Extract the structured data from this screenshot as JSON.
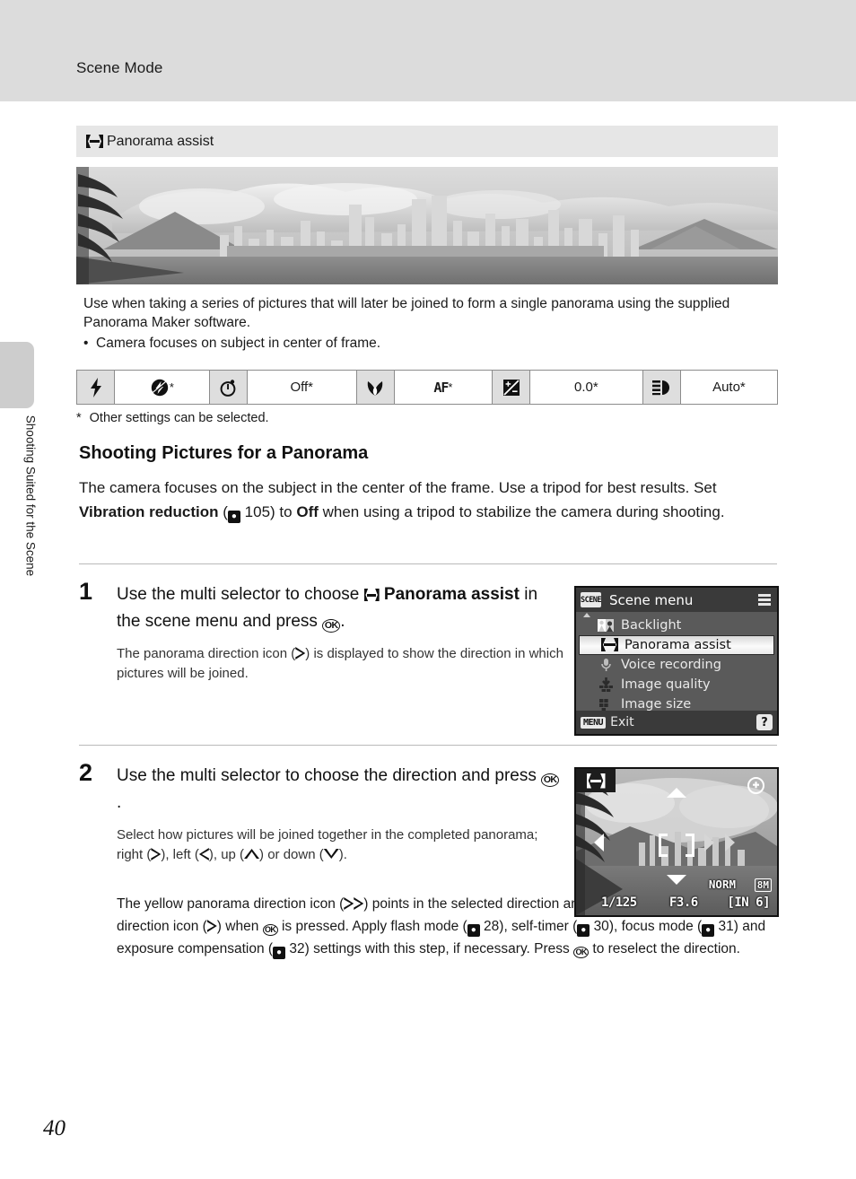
{
  "header": {
    "title": "Scene Mode"
  },
  "side_tab": {
    "label": "Shooting Suited for the Scene"
  },
  "scene_bar": {
    "label": "Panorama assist",
    "icon": "panorama-icon"
  },
  "description": {
    "line1": "Use when taking a series of pictures that will later be joined to form a single panorama using the supplied Panorama Maker software.",
    "bullet1": "Camera focuses on subject in center of frame."
  },
  "settings_row": {
    "items": [
      {
        "icon": "flash-icon",
        "value": "",
        "icon_name": "flash-bolt-icon"
      },
      {
        "icon": "flash-off-icon",
        "value": "*",
        "icon_name": "flash-off-icon"
      },
      {
        "icon": "self-timer-icon",
        "value": "Off*",
        "icon_name": "self-timer-clock-icon"
      },
      {
        "icon": "macro-icon",
        "value": "AF*",
        "icon_name": "macro-flower-icon"
      },
      {
        "icon": "exposure-comp-icon",
        "value": "0.0*",
        "icon_name": "exposure-compensation-icon"
      },
      {
        "icon": "white-balance-icon",
        "value": "Auto*",
        "icon_name": "white-balance-icon"
      }
    ]
  },
  "footnote": {
    "marker": "*",
    "text": "Other settings can be selected."
  },
  "section": {
    "heading": "Shooting Pictures for a Panorama",
    "para_a": "The camera focuses on the subject in the center of the frame. Use a tripod for best results. Set ",
    "para_bold1": "Vibration reduction",
    "para_b": " (",
    "para_ref": "105",
    "para_c": ") to ",
    "para_bold2": "Off",
    "para_d": " when using a tripod to stabilize the camera during shooting."
  },
  "steps": [
    {
      "number": "1",
      "head_a": "Use the multi selector to choose ",
      "head_bold": "Panorama assist",
      "head_b": " in the scene menu and press ",
      "head_c": ".",
      "body_a": "The panorama direction icon (",
      "body_b": ") is displayed to show the direction in which pictures will be joined."
    },
    {
      "number": "2",
      "head_a": "Use the multi selector to choose the direction and press ",
      "head_c": ".",
      "body_a": "Select how pictures will be joined together in the completed panorama; right (",
      "body_b": "), left (",
      "body_c": "), up (",
      "body_d": ") or down (",
      "body_e": ")."
    }
  ],
  "tail": {
    "a": "The yellow panorama direction icon (",
    "b": ") points in the selected direction and becomes the white panorama direction icon (",
    "c": ") when ",
    "d": " is pressed. Apply flash mode (",
    "ref1": "28",
    "e": "), self-timer (",
    "ref2": "30",
    "f": "), focus mode (",
    "ref3": "31",
    "g": ") and exposure compensation (",
    "ref4": "32",
    "h": ") settings with this step, if necessary. Press ",
    "i": " to reselect the direction."
  },
  "lcd_scene_menu": {
    "badge": "SCENE",
    "title": "Scene menu",
    "items": [
      {
        "label": "Backlight",
        "icon": "backlight-icon",
        "selected": false
      },
      {
        "label": "Panorama assist",
        "icon": "panorama-icon",
        "selected": true
      },
      {
        "label": "Voice recording",
        "icon": "microphone-icon",
        "selected": false
      },
      {
        "label": "Image quality",
        "icon": "image-quality-icon",
        "selected": false
      },
      {
        "label": "Image size",
        "icon": "image-size-icon",
        "selected": false
      }
    ],
    "bottom_button": "MENU",
    "bottom_label": "Exit",
    "help_button": "?"
  },
  "lcd_panorama": {
    "mode_icon": "panorama-icon",
    "vr_icon": "vibration-reduction-icon",
    "quality": "NORM",
    "image_size": "8M",
    "shutter_speed": "1/125",
    "aperture": "F3.6",
    "shots_remaining": "[IN   6]"
  },
  "page": {
    "number": "40"
  },
  "colors": {
    "header_band": "#dcdcdc",
    "scene_bar": "#e6e6e6",
    "settings_icon_cell": "#dedede",
    "lcd_background": "#5a5a5a",
    "lcd_bar": "#3a3a3a",
    "rule": "#b9b9b9"
  }
}
